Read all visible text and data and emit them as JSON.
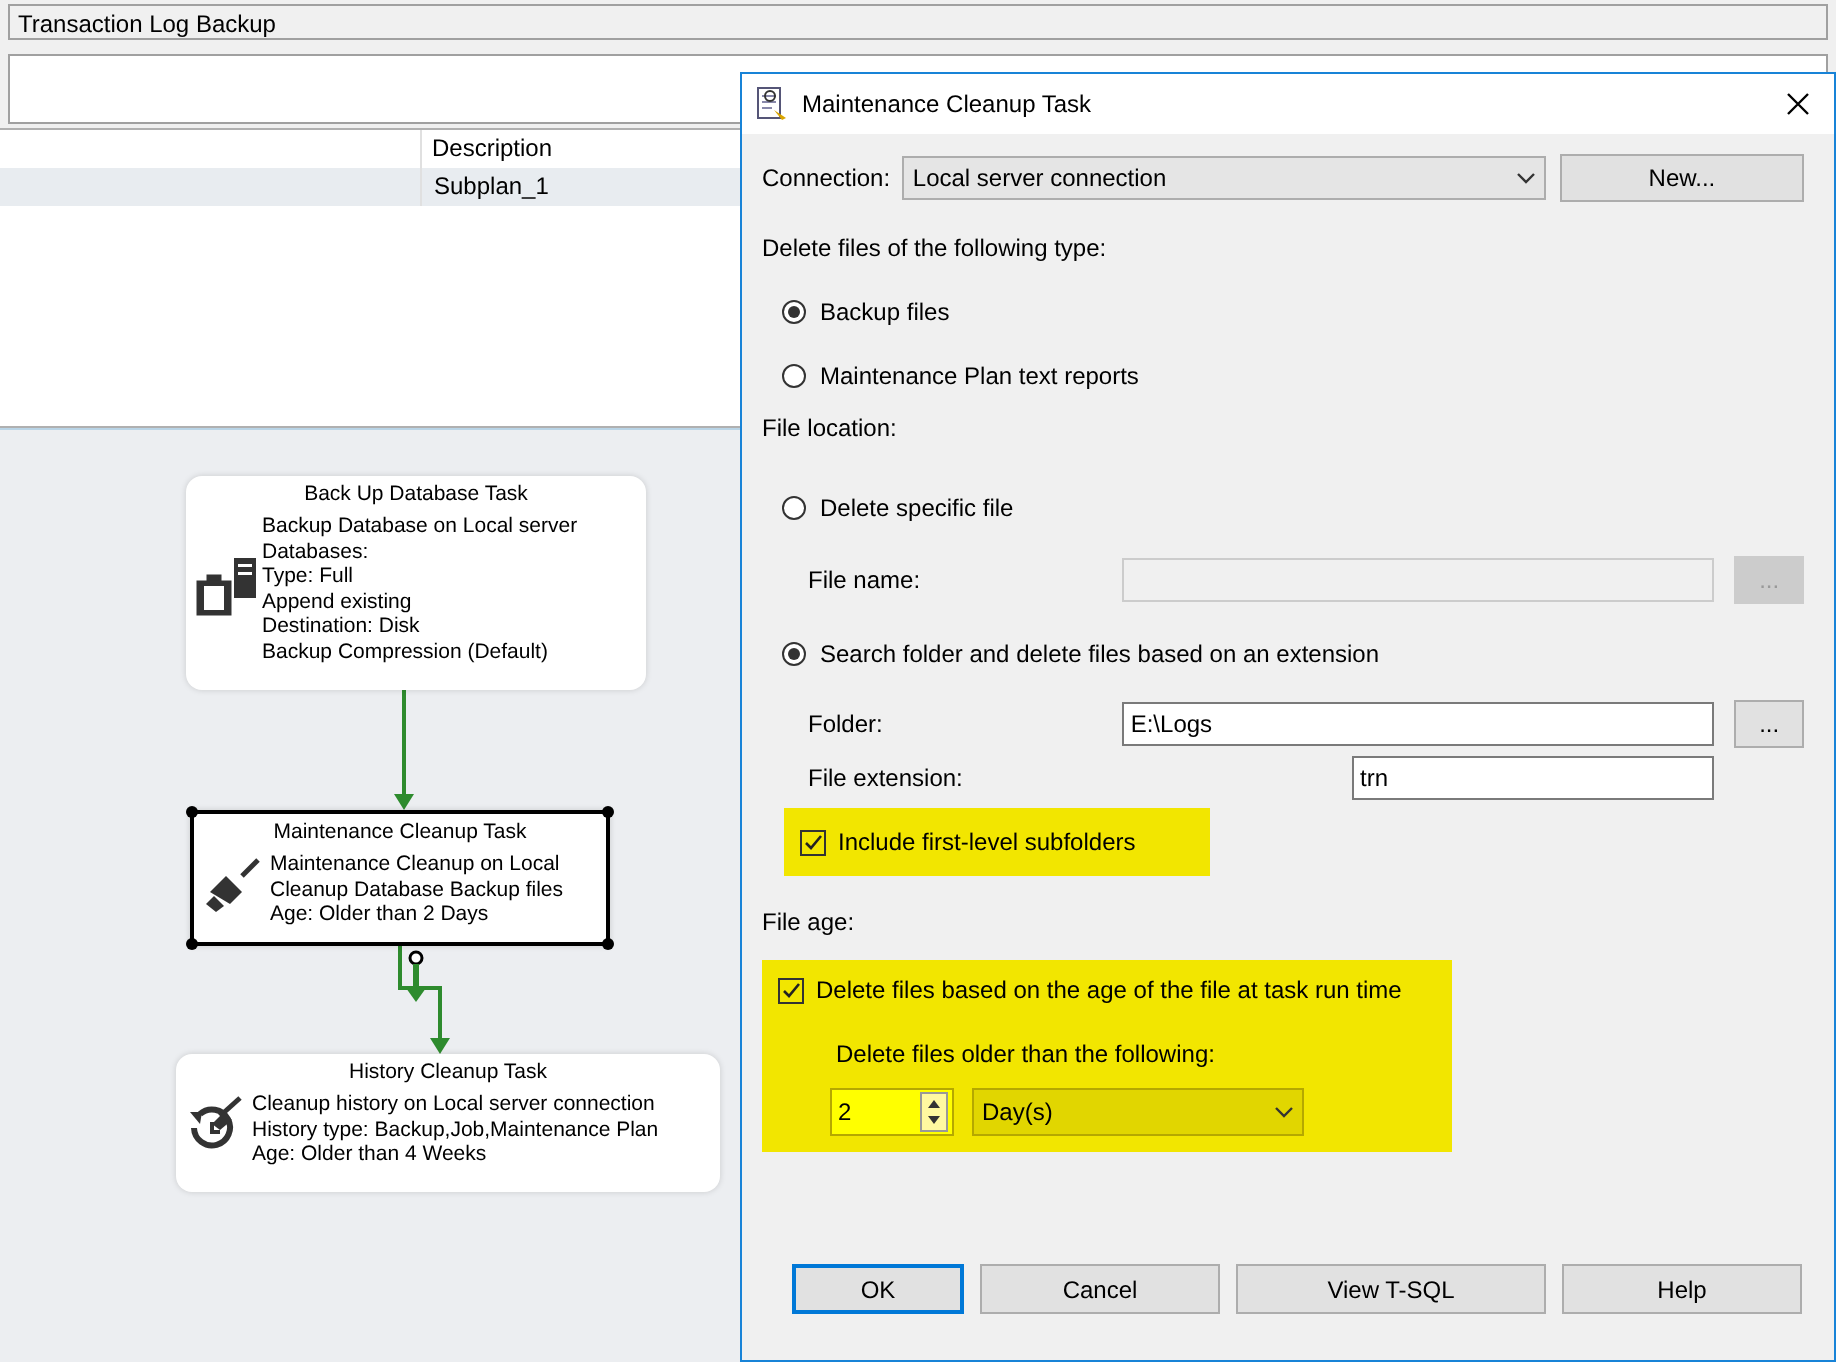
{
  "background_window": {
    "plan_name": "Transaction Log Backup",
    "table": {
      "columns": [
        "Description"
      ],
      "rows": [
        {
          "cells": [
            "Subplan_1"
          ],
          "selected": true
        }
      ]
    }
  },
  "designer": {
    "tasks": [
      {
        "kind": "backup",
        "title": "Back Up Database Task",
        "selected": false,
        "lines": [
          "Backup Database on Local server",
          "Databases:",
          "Type: Full",
          "Append existing",
          "Destination: Disk",
          "Backup Compression (Default)"
        ]
      },
      {
        "kind": "cleanup",
        "title": "Maintenance Cleanup Task",
        "selected": true,
        "lines": [
          "Maintenance Cleanup on Local",
          "Cleanup Database Backup files",
          "Age: Older than 2 Days"
        ]
      },
      {
        "kind": "history",
        "title": "History Cleanup Task",
        "selected": false,
        "lines": [
          "Cleanup history on Local server connection",
          "History type: Backup,Job,Maintenance Plan",
          "Age: Older than 4 Weeks"
        ]
      }
    ]
  },
  "dialog": {
    "title": "Maintenance Cleanup Task",
    "connection": {
      "label": "Connection:",
      "value": "Local server connection",
      "new_button": "New..."
    },
    "file_type": {
      "heading": "Delete files of the following type:",
      "options": [
        {
          "label": "Backup files",
          "selected": true
        },
        {
          "label": "Maintenance Plan text reports",
          "selected": false
        }
      ]
    },
    "file_location": {
      "heading": "File location:",
      "specific": {
        "label": "Delete specific file",
        "selected": false,
        "field_label": "File name:",
        "browse": "..."
      },
      "search": {
        "label": "Search folder and delete files based on an extension",
        "selected": true,
        "folder_label": "Folder:",
        "folder": "E:\\Logs",
        "browse": "...",
        "extension_label": "File extension:",
        "extension": "trn",
        "subfolders": {
          "label": "Include first-level subfolders",
          "checked": true,
          "highlighted": true
        }
      }
    },
    "file_age": {
      "heading": "File age:",
      "by_age": {
        "label": "Delete files based on the age of the file at task run time",
        "checked": true,
        "highlighted": true
      },
      "older_than_label": "Delete files older than the following:",
      "amount": "2",
      "unit": "Day(s)"
    },
    "buttons": [
      {
        "label": "OK",
        "default": true
      },
      {
        "label": "Cancel",
        "default": false
      },
      {
        "label": "View T-SQL",
        "default": false
      },
      {
        "label": "Help",
        "default": false
      }
    ]
  }
}
